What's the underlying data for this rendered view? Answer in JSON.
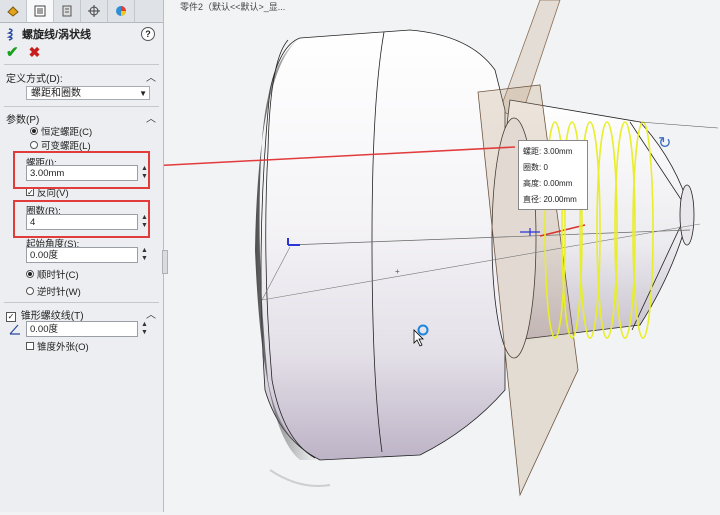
{
  "colors": {
    "accent_red": "#e23b3b",
    "helix_yellow": "#e8ee2a",
    "ok_green": "#19a01e",
    "cancel_red": "#c81d1d"
  },
  "document_title": "零件2（默认<<默认>_显...",
  "panel": {
    "tabs": [
      "feature-manager-icon",
      "property-manager-icon",
      "config-manager-icon",
      "dimxpert-icon",
      "display-manager-icon"
    ],
    "title": "螺旋线/涡状线",
    "help": "?",
    "definition": {
      "header": "定义方式(D):",
      "selected": "螺距和圈数"
    },
    "parameters": {
      "header": "参数(P)",
      "mode_constant": "恒定螺距(C)",
      "mode_variable": "可变螺距(L)",
      "pitch_label": "螺距(I):",
      "pitch_value": "3.00mm",
      "reverse_label": "反向(V)",
      "revolutions_label": "圈数(R):",
      "revolutions_value": "4",
      "start_angle_label": "起始角度(S):",
      "start_angle_value": "0.00度",
      "clockwise": "顺时针(C)",
      "counterclockwise": "逆时针(W)"
    },
    "taper": {
      "header": "锥形螺纹线(T)",
      "angle_value": "0.00度",
      "taper_outward": "锥度外张(O)"
    }
  },
  "callout": {
    "pitch_label": "螺距:",
    "pitch_value": "3.00mm",
    "revs_label": "圈数:",
    "revs_value": "0",
    "height_label": "高度:",
    "height_value": "0.00mm",
    "diameter_label": "直径:",
    "diameter_value": "20.00mm"
  }
}
